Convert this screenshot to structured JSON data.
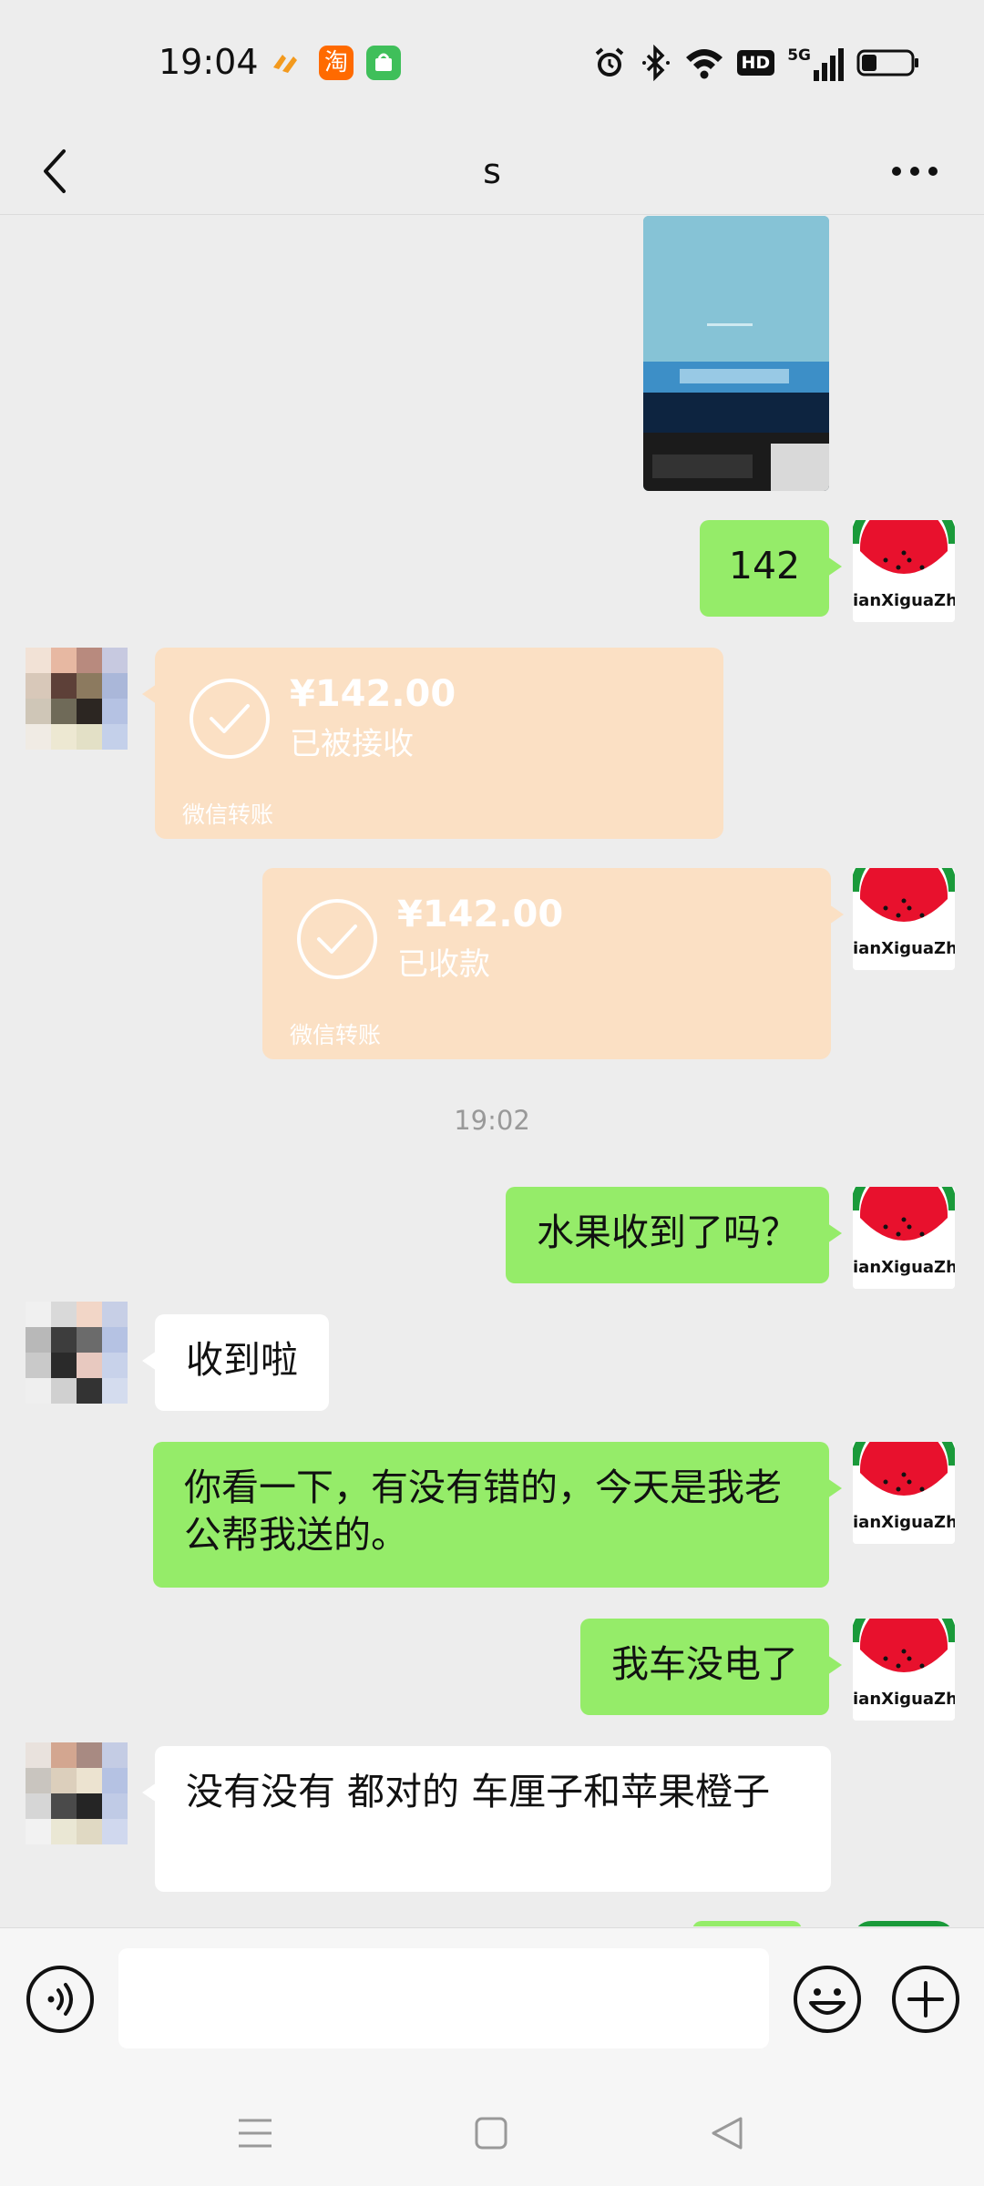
{
  "status_bar": {
    "time": "19:04",
    "apps": [
      "pay-icon",
      "taobao-icon",
      "store-icon"
    ],
    "taobao_char": "淘",
    "hd_label": "HD",
    "network_label": "5G",
    "battery_level": 0.3
  },
  "header": {
    "title": "s",
    "back_icon": "chevron-left-icon",
    "more_icon": "more-dots-icon"
  },
  "chat": {
    "me_avatar_text": "ianXiguaZha",
    "messages": {
      "msg_142": "142",
      "transfer_1": {
        "amount": "¥142.00",
        "status": "已被接收",
        "label": "微信转账"
      },
      "transfer_2": {
        "amount": "¥142.00",
        "status": "已收款",
        "label": "微信转账"
      },
      "timestamp": "19:02",
      "msg_fruit": "水果收到了吗？",
      "msg_received": "收到啦",
      "msg_check": "你看一下，有没有错的，今天是我老公帮我送的。",
      "msg_car": "我车没电了",
      "msg_correct": "没有没有 都对的 车厘子和苹果橙子"
    }
  },
  "input_bar": {
    "voice_icon": "voice-icon",
    "emoji_icon": "emoji-icon",
    "plus_icon": "plus-icon"
  },
  "nav_bar": {
    "menu_icon": "menu-icon",
    "home_icon": "home-square-icon",
    "back_icon": "back-triangle-icon"
  },
  "colors": {
    "background": "#ededed",
    "bubble_green": "#95ec69",
    "bubble_white": "#ffffff",
    "transfer_bg": "#fbe0c4",
    "watermelon_red": "#e8112d",
    "watermelon_green": "#1a9a3a"
  }
}
